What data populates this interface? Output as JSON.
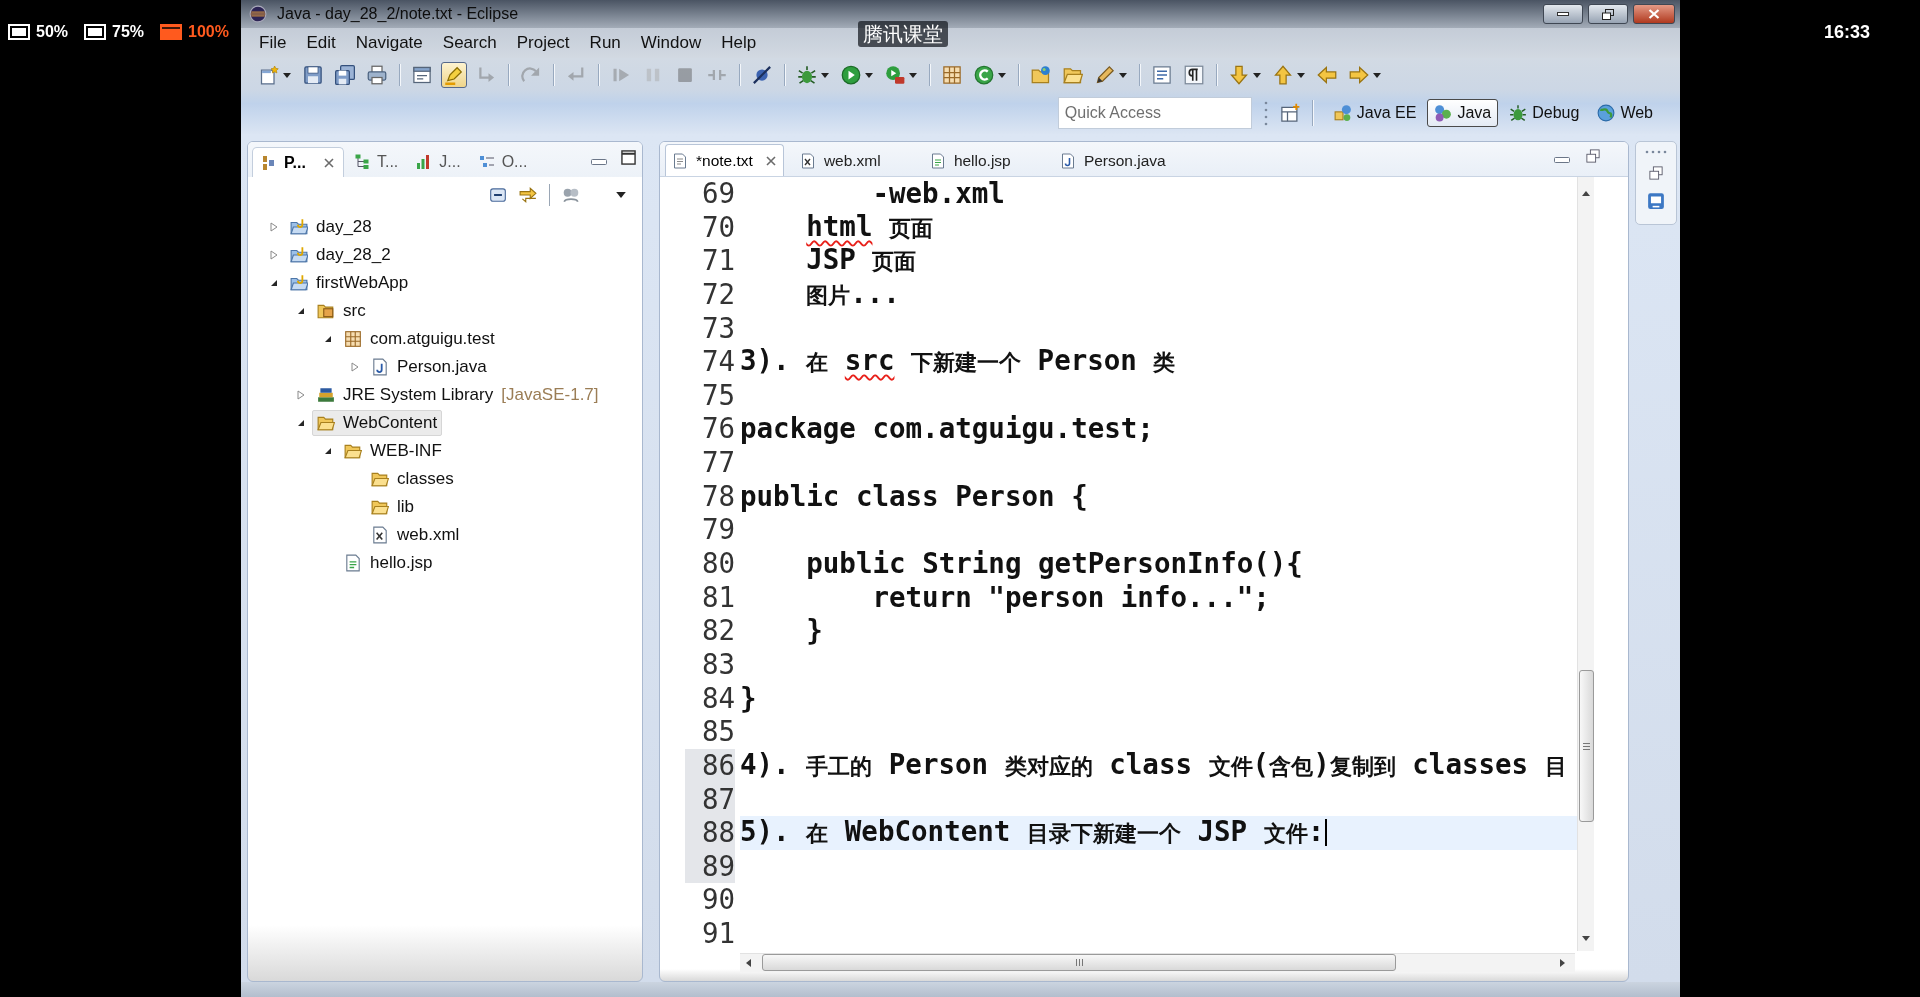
{
  "player": {
    "zoom_options": [
      {
        "label": "50%",
        "selected": false
      },
      {
        "label": "75%",
        "selected": false
      },
      {
        "label": "100%",
        "selected": true
      }
    ],
    "title": "腾讯课堂",
    "clock": "16:33"
  },
  "window": {
    "title": "Java - day_28_2/note.txt - Eclipse"
  },
  "menu": [
    "File",
    "Edit",
    "Navigate",
    "Search",
    "Project",
    "Run",
    "Window",
    "Help"
  ],
  "toolbar": [
    [
      {
        "kind": "new",
        "disabled": false,
        "pressed": false,
        "dropdown": true
      },
      {
        "kind": "save",
        "disabled": false,
        "pressed": false,
        "dropdown": false
      },
      {
        "kind": "save-all",
        "disabled": false,
        "pressed": false,
        "dropdown": false
      },
      {
        "kind": "print",
        "disabled": false,
        "pressed": false,
        "dropdown": false
      }
    ],
    [
      {
        "kind": "console",
        "disabled": false,
        "pressed": false,
        "dropdown": false
      },
      {
        "kind": "mark-occurrences",
        "disabled": false,
        "pressed": true,
        "dropdown": false
      },
      {
        "kind": "drop-to-frame",
        "disabled": true,
        "pressed": false,
        "dropdown": false
      }
    ],
    [
      {
        "kind": "step-over",
        "disabled": true,
        "pressed": false,
        "dropdown": false
      }
    ],
    [
      {
        "kind": "step-return",
        "disabled": true,
        "pressed": false,
        "dropdown": false
      }
    ],
    [
      {
        "kind": "resume",
        "disabled": true,
        "pressed": false,
        "dropdown": false
      },
      {
        "kind": "suspend",
        "disabled": true,
        "pressed": false,
        "dropdown": false
      },
      {
        "kind": "terminate",
        "disabled": true,
        "pressed": false,
        "dropdown": false
      },
      {
        "kind": "disconnect",
        "disabled": true,
        "pressed": false,
        "dropdown": false
      }
    ],
    [
      {
        "kind": "skip-breakpoints",
        "disabled": false,
        "pressed": false,
        "dropdown": false
      }
    ],
    [
      {
        "kind": "debug",
        "disabled": false,
        "pressed": false,
        "dropdown": true
      },
      {
        "kind": "run",
        "disabled": false,
        "pressed": false,
        "dropdown": true
      },
      {
        "kind": "external-tools",
        "disabled": false,
        "pressed": false,
        "dropdown": true
      }
    ],
    [
      {
        "kind": "new-package",
        "disabled": false,
        "pressed": false,
        "dropdown": false
      },
      {
        "kind": "new-class",
        "disabled": false,
        "pressed": false,
        "dropdown": true
      }
    ],
    [
      {
        "kind": "open-type",
        "disabled": false,
        "pressed": false,
        "dropdown": false
      },
      {
        "kind": "open-folder",
        "disabled": false,
        "pressed": false,
        "dropdown": false
      },
      {
        "kind": "search",
        "disabled": false,
        "pressed": false,
        "dropdown": true
      }
    ],
    [
      {
        "kind": "text-box",
        "disabled": false,
        "pressed": false,
        "dropdown": false
      },
      {
        "kind": "whitespace",
        "disabled": false,
        "pressed": false,
        "dropdown": false
      }
    ],
    [
      {
        "kind": "next-annotation",
        "disabled": false,
        "pressed": false,
        "dropdown": true
      },
      {
        "kind": "prev-annotation",
        "disabled": false,
        "pressed": false,
        "dropdown": true
      },
      {
        "kind": "back",
        "disabled": false,
        "pressed": false,
        "dropdown": false
      },
      {
        "kind": "forward",
        "disabled": false,
        "pressed": false,
        "dropdown": true
      }
    ]
  ],
  "quick_access": {
    "placeholder": "Quick Access"
  },
  "perspectives": [
    {
      "label": "Java EE",
      "kind": "java-ee",
      "selected": false
    },
    {
      "label": "Java",
      "kind": "java",
      "selected": true
    },
    {
      "label": "Debug",
      "kind": "debug",
      "selected": false
    },
    {
      "label": "Web",
      "kind": "web",
      "selected": false
    }
  ],
  "package_explorer": {
    "tabs": [
      {
        "label": "P...",
        "kind": "packages",
        "selected": true
      },
      {
        "label": "T...",
        "kind": "hierarchy",
        "selected": false
      },
      {
        "label": "J...",
        "kind": "junit",
        "selected": false
      },
      {
        "label": "O...",
        "kind": "outline",
        "selected": false
      }
    ],
    "tree": [
      {
        "label": "day_28",
        "kind": "project",
        "expandable": true,
        "expanded": false,
        "selected": false
      },
      {
        "label": "day_28_2",
        "kind": "project",
        "expandable": true,
        "expanded": false,
        "selected": false
      },
      {
        "label": "firstWebApp",
        "kind": "project",
        "expandable": true,
        "expanded": true,
        "selected": false,
        "children": [
          {
            "label": "src",
            "kind": "source-folder",
            "expandable": true,
            "expanded": true,
            "selected": false,
            "children": [
              {
                "label": "com.atguigu.test",
                "kind": "package",
                "expandable": true,
                "expanded": true,
                "selected": false,
                "children": [
                  {
                    "label": "Person.java",
                    "kind": "java-file",
                    "expandable": true,
                    "expanded": false,
                    "selected": false
                  }
                ]
              }
            ]
          },
          {
            "label": "JRE System Library",
            "decoration": "[JavaSE-1.7]",
            "kind": "library",
            "expandable": true,
            "expanded": false,
            "selected": false
          },
          {
            "label": "WebContent",
            "kind": "folder",
            "expandable": true,
            "expanded": true,
            "selected": true,
            "children": [
              {
                "label": "WEB-INF",
                "kind": "folder",
                "expandable": true,
                "expanded": true,
                "selected": false,
                "children": [
                  {
                    "label": "classes",
                    "kind": "folder",
                    "expandable": false,
                    "selected": false
                  },
                  {
                    "label": "lib",
                    "kind": "folder",
                    "expandable": false,
                    "selected": false
                  },
                  {
                    "label": "web.xml",
                    "kind": "xml-file",
                    "expandable": false,
                    "selected": false
                  }
                ]
              },
              {
                "label": "hello.jsp",
                "kind": "jsp-file",
                "expandable": false,
                "selected": false
              }
            ]
          }
        ]
      }
    ]
  },
  "editor": {
    "tabs": [
      {
        "label": "*note.txt",
        "kind": "text",
        "selected": true
      },
      {
        "label": "web.xml",
        "kind": "xml",
        "selected": false
      },
      {
        "label": "hello.jsp",
        "kind": "jsp",
        "selected": false
      },
      {
        "label": "Person.java",
        "kind": "java",
        "selected": false
      }
    ],
    "lines": [
      {
        "number": "69",
        "text": "        -web.xml",
        "current": false,
        "changed": false
      },
      {
        "number": "70",
        "parts": [
          {
            "text": "    html",
            "misspelled": true
          },
          {
            "text": " 页面",
            "misspelled": false
          }
        ],
        "current": false,
        "changed": false
      },
      {
        "number": "71",
        "text": "    JSP 页面",
        "current": false,
        "changed": false
      },
      {
        "number": "72",
        "text": "    图片...",
        "current": false,
        "changed": false
      },
      {
        "number": "73",
        "current": false,
        "changed": false
      },
      {
        "number": "74",
        "parts": [
          {
            "text": "3). 在 ",
            "misspelled": false
          },
          {
            "text": "src",
            "misspelled": true
          },
          {
            "text": " 下新建一个 Person 类",
            "misspelled": false
          }
        ],
        "current": false,
        "changed": false
      },
      {
        "number": "75",
        "current": false,
        "changed": false
      },
      {
        "number": "76",
        "text": "package com.atguigu.test;",
        "current": false,
        "changed": false
      },
      {
        "number": "77",
        "current": false,
        "changed": false
      },
      {
        "number": "78",
        "text": "public class Person {",
        "current": false,
        "changed": false
      },
      {
        "number": "79",
        "current": false,
        "changed": false
      },
      {
        "number": "80",
        "text": "    public String getPersonInfo(){",
        "current": false,
        "changed": false
      },
      {
        "number": "81",
        "text": "        return \"person info...\";",
        "current": false,
        "changed": false
      },
      {
        "number": "82",
        "text": "    }",
        "current": false,
        "changed": false
      },
      {
        "number": "83",
        "current": false,
        "changed": false
      },
      {
        "number": "84",
        "text": "}",
        "current": false,
        "changed": false
      },
      {
        "number": "85",
        "current": false,
        "changed": false
      },
      {
        "number": "86",
        "text": "4). 手工的 Person 类对应的 class 文件(含包)复制到 classes 目",
        "current": false,
        "changed": true
      },
      {
        "number": "87",
        "current": false,
        "changed": true
      },
      {
        "number": "88",
        "text": "5). 在 WebContent 目录下新建一个 JSP 文件:",
        "current": true,
        "changed": true
      },
      {
        "number": "89",
        "current": false,
        "changed": true
      },
      {
        "number": "90",
        "current": false,
        "changed": false
      },
      {
        "number": "91",
        "current": false,
        "changed": false
      }
    ]
  }
}
